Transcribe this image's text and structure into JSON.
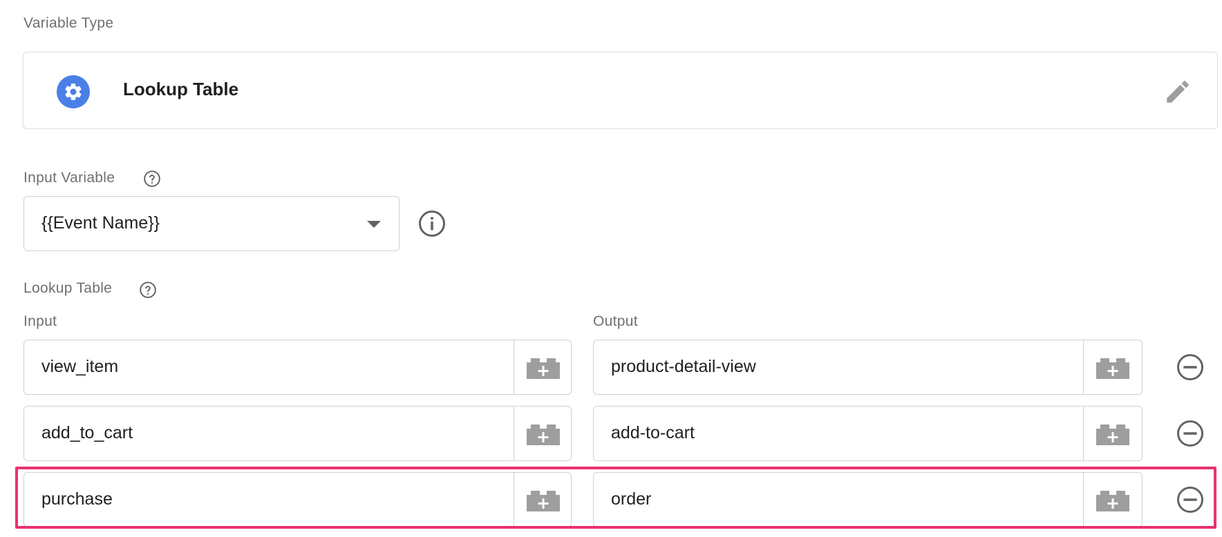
{
  "variable_type": {
    "section_label": "Variable Type",
    "type_name": "Lookup Table",
    "type_icon": "gear-icon",
    "edit_icon": "pencil-icon"
  },
  "input_variable": {
    "section_label": "Input Variable",
    "selected_value": "{{Event Name}}"
  },
  "lookup_table": {
    "section_label": "Lookup Table",
    "input_header": "Input",
    "output_header": "Output",
    "rows": [
      {
        "input": "view_item",
        "output": "product-detail-view"
      },
      {
        "input": "add_to_cart",
        "output": "add-to-cart"
      },
      {
        "input": "purchase",
        "output": "order"
      }
    ],
    "highlighted_row": 3
  },
  "colors": {
    "accent_blue": "#4a7fe8",
    "highlight": "#e8336e",
    "border": "#d0d0d0",
    "label_gray": "#6f6f6f",
    "icon_gray": "#9e9e9e"
  }
}
